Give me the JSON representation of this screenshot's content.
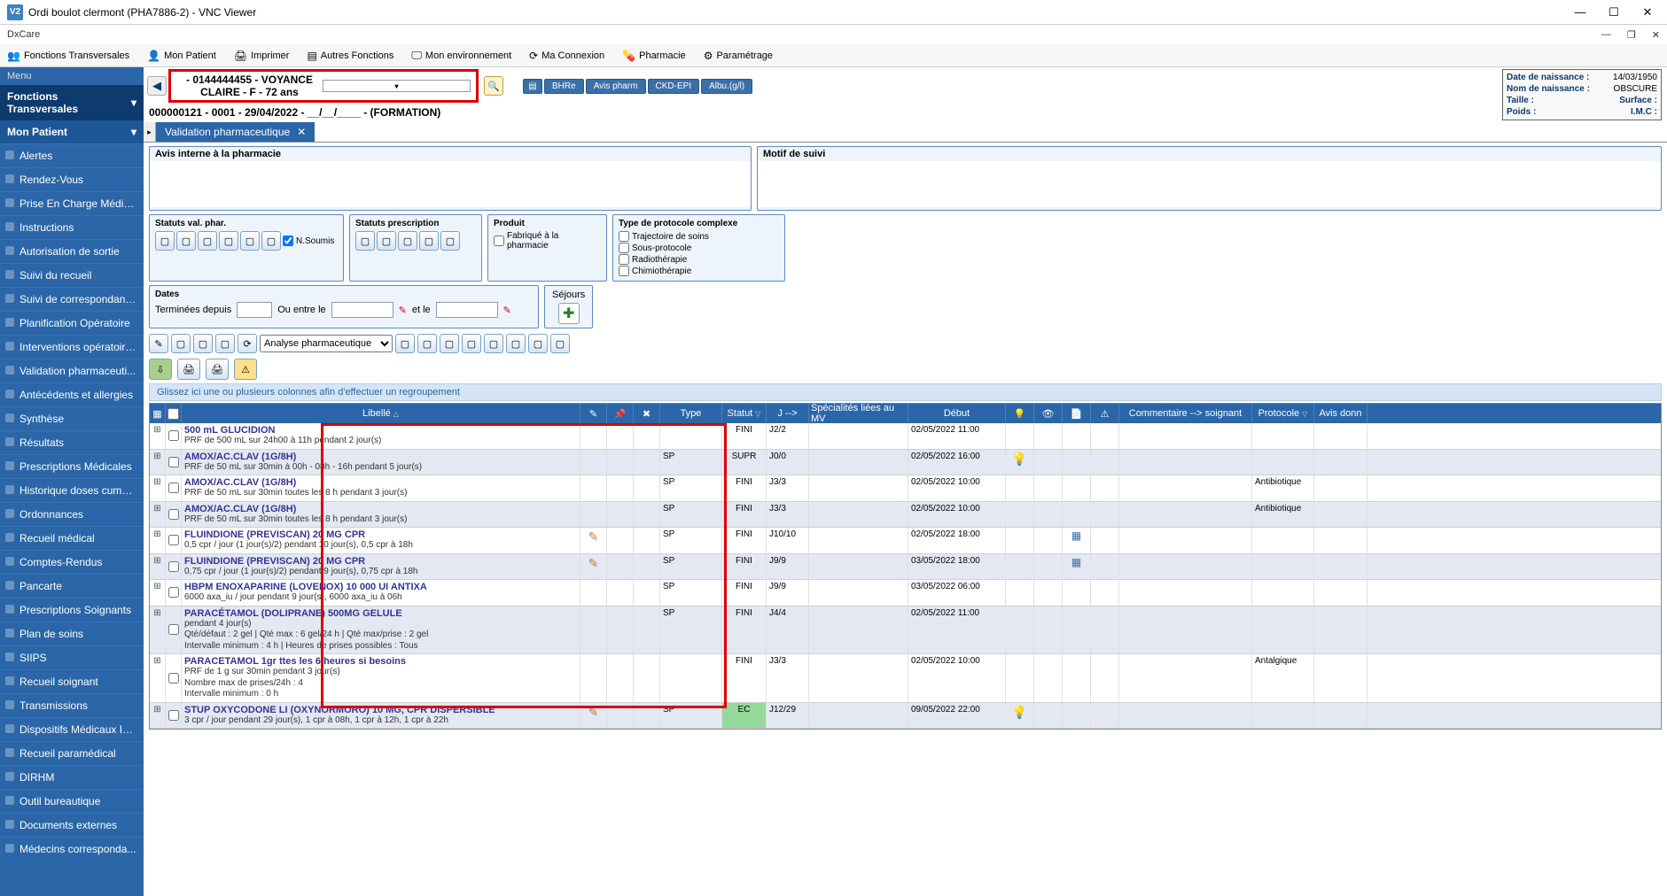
{
  "window": {
    "title": "Ordi boulot clermont (PHA7886-2) - VNC Viewer",
    "app_label": "DxCare"
  },
  "menubar": [
    "Fonctions Transversales",
    "Mon Patient",
    "Imprimer",
    "Autres Fonctions",
    "Mon environnement",
    "Ma Connexion",
    "Pharmacie",
    "Paramétrage"
  ],
  "sidebar": {
    "menu_label": "Menu",
    "sections": [
      {
        "label": "Fonctions Transversales",
        "type": "head"
      },
      {
        "label": "Mon Patient",
        "type": "head"
      }
    ],
    "items": [
      "Alertes",
      "Rendez-Vous",
      "Prise En Charge Médicale",
      "Instructions",
      "Autorisation de sortie",
      "Suivi du recueil",
      "Suivi de correspondance",
      "Planification Opératoire",
      "Interventions opératoires",
      "Validation pharmaceuti...",
      "Antécédents et allergies",
      "Synthèse",
      "Résultats",
      "Prescriptions Médicales",
      "Historique doses cumul...",
      "Ordonnances",
      "Recueil médical",
      "Comptes-Rendus",
      "Pancarte",
      "Prescriptions Soignants",
      "Plan de soins",
      "SIIPS",
      "Recueil soignant",
      "Transmissions",
      "Dispositifs Médicaux Im...",
      "Recueil paramédical",
      "DIRHM",
      "Outil bureautique",
      "Documents externes",
      "Médecins corresponda..."
    ]
  },
  "patient_header": {
    "name_line": "- 0144444455 - VOYANCE CLAIRE - F - 72 ans",
    "visit_line": "000000121 - 0001 - 29/04/2022 - __/__/____ - (FORMATION)",
    "tags": [
      "BHRe",
      "Avis pharm",
      "CKD-EPI",
      "Albu.(g/l)"
    ],
    "info": {
      "dob_label": "Date de naissance :",
      "dob": "14/03/1950",
      "bname_label": "Nom de naissance :",
      "bname": "OBSCURE",
      "taille_label": "Taille :",
      "surface_label": "Surface :",
      "poids_label": "Poids :",
      "imc_label": "I.M.C :"
    }
  },
  "tab": {
    "label": "Validation pharmaceutique"
  },
  "panels": {
    "avis_title": "Avis interne à la pharmacie",
    "motif_title": "Motif de suivi"
  },
  "filters": {
    "statuts_val": "Statuts val. phar.",
    "nsoumis": "N.Soumis",
    "statuts_presc": "Statuts prescription",
    "produit_title": "Produit",
    "produit_chk": "Fabriqué à la pharmacie",
    "proto_title": "Type de protocole complexe",
    "proto_items": [
      "Trajectoire de soins",
      "Sous-protocole",
      "Radiothérapie",
      "Chimiothérapie"
    ],
    "dates_title": "Dates",
    "dates_term": "Terminées depuis",
    "dates_ou": "Ou entre le",
    "dates_et": "et le",
    "sejours": "Séjours",
    "analyse_sel": "Analyse pharmaceutique"
  },
  "group_hint": "Glissez ici une ou plusieurs colonnes afin d'effectuer un regroupement",
  "grid_headers": {
    "libelle": "Libellé",
    "type": "Type",
    "statut": "Statut",
    "j": "J -->",
    "spec": "Spécialités liées au MV",
    "debut": "Début",
    "commentaire": "Commentaire --> soignant",
    "protocole": "Protocole",
    "avis": "Avis donn"
  },
  "rows": [
    {
      "alt": false,
      "title": "500 mL GLUCIDION",
      "detail": "PRF de 500 mL sur 24h00 à 11h pendant 2 jour(s)",
      "type": "",
      "statut": "FINI",
      "j": "J2/2",
      "debut": "02/05/2022 11:00",
      "pencil": false,
      "bulb": false,
      "doc": false,
      "com": "",
      "prot": ""
    },
    {
      "alt": true,
      "title": "AMOX/AC.CLAV (1G/8H)",
      "detail": "PRF de 50 mL sur 30min à 00h - 08h - 16h pendant 5 jour(s)",
      "type": "SP",
      "statut": "SUPR",
      "j": "J0/0",
      "debut": "02/05/2022 16:00",
      "pencil": false,
      "bulb": true,
      "doc": false,
      "com": "",
      "prot": ""
    },
    {
      "alt": false,
      "title": "AMOX/AC.CLAV (1G/8H)",
      "detail": "PRF de 50 mL sur 30min toutes les 8 h pendant 3 jour(s)",
      "type": "SP",
      "statut": "FINI",
      "j": "J3/3",
      "debut": "02/05/2022 10:00",
      "pencil": false,
      "bulb": false,
      "doc": false,
      "com": "",
      "prot": "Antibiotique"
    },
    {
      "alt": true,
      "title": "AMOX/AC.CLAV (1G/8H)",
      "detail": "PRF de 50 mL sur 30min toutes les 8 h pendant 3 jour(s)",
      "type": "SP",
      "statut": "FINI",
      "j": "J3/3",
      "debut": "02/05/2022 10:00",
      "pencil": false,
      "bulb": false,
      "doc": false,
      "com": "",
      "prot": "Antibiotique"
    },
    {
      "alt": false,
      "title": "FLUINDIONE (PREVISCAN) 20 MG CPR",
      "detail": "0,5 cpr / jour (1 jour(s)/2) pendant 10 jour(s), 0,5 cpr à 18h",
      "type": "SP",
      "statut": "FINI",
      "j": "J10/10",
      "debut": "02/05/2022 18:00",
      "pencil": true,
      "bulb": false,
      "doc": true,
      "com": "",
      "prot": ""
    },
    {
      "alt": true,
      "title": "FLUINDIONE (PREVISCAN) 20 MG CPR",
      "detail": "0,75 cpr / jour (1 jour(s)/2) pendant 9 jour(s), 0,75 cpr à 18h",
      "type": "SP",
      "statut": "FINI",
      "j": "J9/9",
      "debut": "03/05/2022 18:00",
      "pencil": true,
      "bulb": false,
      "doc": true,
      "com": "",
      "prot": ""
    },
    {
      "alt": false,
      "title": "HBPM ENOXAPARINE (LOVENOX) 10 000 UI ANTIXA",
      "detail": "6000 axa_iu / jour pendant 9 jour(s), 6000 axa_iu à 06h",
      "type": "SP",
      "statut": "FINI",
      "j": "J9/9",
      "debut": "03/05/2022 06:00",
      "pencil": false,
      "bulb": false,
      "doc": false,
      "com": "",
      "prot": ""
    },
    {
      "alt": true,
      "title": "PARACÉTAMOL (DOLIPRANE) 500MG GELULE",
      "detail": "pendant 4 jour(s)\nQté/défaut : 2 gel | Qté max : 6 gel/24 h | Qté max/prise : 2 gel\nIntervalle minimum : 4 h | Heures de prises possibles : Tous",
      "type": "SP",
      "statut": "FINI",
      "j": "J4/4",
      "debut": "02/05/2022 11:00",
      "pencil": false,
      "bulb": false,
      "doc": false,
      "com": "",
      "prot": ""
    },
    {
      "alt": false,
      "title": "PARACETAMOL 1gr ttes les 6 heures si besoins",
      "detail": "PRF de 1 g sur 30min pendant 3 jour(s)\nNombre max de prises/24h : 4\nIntervalle minimum : 0 h",
      "type": "",
      "statut": "FINI",
      "j": "J3/3",
      "debut": "02/05/2022 10:00",
      "pencil": false,
      "bulb": false,
      "doc": false,
      "com": "",
      "prot": "Antalgique"
    },
    {
      "alt": true,
      "title": "STUP OXYCODONE LI (OXYNORMORO) 10 MG, CPR DISPERSIBLE",
      "detail": "3 cpr / jour pendant 29 jour(s), 1 cpr à 08h, 1 cpr à 12h, 1 cpr à 22h",
      "type": "SP",
      "statut": "EC",
      "j": "J12/29",
      "debut": "09/05/2022 22:00",
      "pencil": true,
      "bulb": true,
      "doc": false,
      "com": "",
      "prot": ""
    }
  ]
}
